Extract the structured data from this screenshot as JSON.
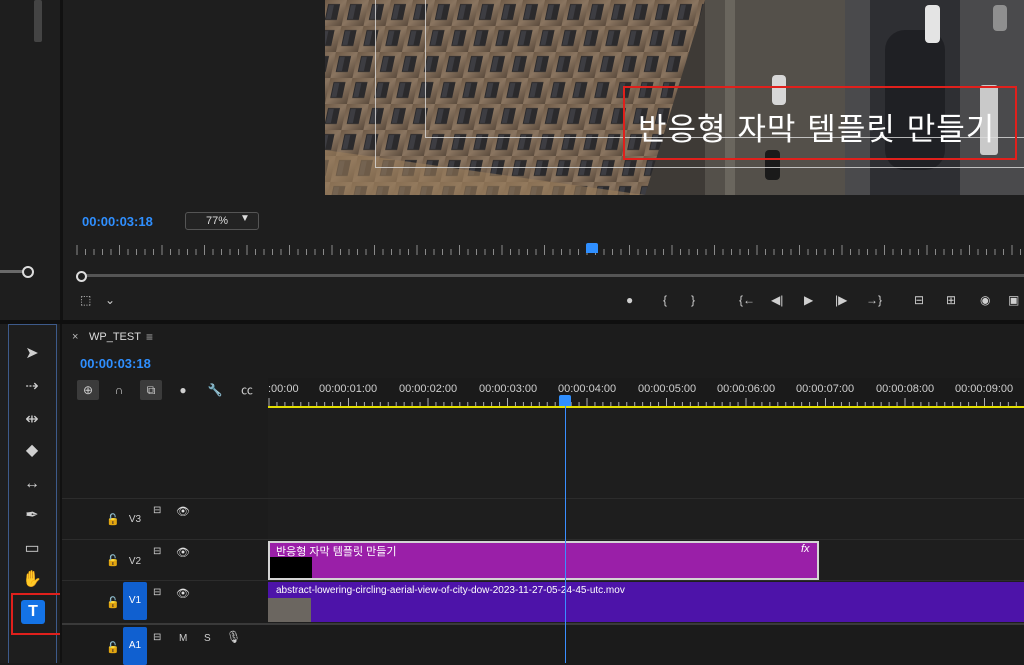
{
  "program_monitor": {
    "title_overlay": "반응형 자막 템플릿 만들기",
    "timecode": "00:00:03:18",
    "zoom": "77%",
    "playhead_fraction": 0.545
  },
  "transport": {
    "marker": "●",
    "in": "{",
    "out": "}",
    "goto_in": "{←",
    "step_back": "◀|",
    "play": "▶",
    "step_fwd": "|▶",
    "goto_out": "→}",
    "lift": "⊟",
    "extract": "⊞",
    "export_frame": "◉"
  },
  "tools": [
    {
      "name": "selection-tool",
      "glyph": "➤"
    },
    {
      "name": "track-select-tool",
      "glyph": "⇢"
    },
    {
      "name": "ripple-edit-tool",
      "glyph": "⇹"
    },
    {
      "name": "razor-tool",
      "glyph": "◆"
    },
    {
      "name": "slip-tool",
      "glyph": "↔"
    },
    {
      "name": "pen-tool",
      "glyph": "✒"
    },
    {
      "name": "rectangle-tool",
      "glyph": "▭"
    },
    {
      "name": "hand-tool",
      "glyph": "✋"
    }
  ],
  "type_tool": "T",
  "sequence": {
    "close": "×",
    "name": "WP_TEST",
    "menu": "≡",
    "timecode": "00:00:03:18",
    "ruler": [
      ":00:00",
      "00:00:01:00",
      "00:00:02:00",
      "00:00:03:00",
      "00:00:04:00",
      "00:00:05:00",
      "00:00:06:00",
      "00:00:07:00",
      "00:00:08:00",
      "00:00:09:00"
    ],
    "options": [
      "⊕",
      "∩",
      "⧉",
      "●",
      "🔧",
      "㏄"
    ]
  },
  "tracks": [
    {
      "label": "V3",
      "lock": "🔓",
      "sync": "⊟",
      "eye": "👁"
    },
    {
      "label": "V2",
      "lock": "🔓",
      "sync": "⊟",
      "eye": "👁"
    },
    {
      "label": "V1",
      "lock": "🔓",
      "sync": "⊟",
      "eye": "👁"
    },
    {
      "label": "A1",
      "lock": "🔓",
      "sync": "⊟",
      "mute": "M",
      "solo": "S",
      "mic": "🎙"
    }
  ],
  "clips": {
    "title_clip": {
      "name": "반응형 자막 템플릿 만들기",
      "fx": "fx"
    },
    "video_clip": {
      "name": "abstract-lowering-circling-aerial-view-of-city-dow-2023-11-27-05-24-45-utc.mov"
    }
  },
  "colors": {
    "accent": "#2f8fff",
    "title_clip": "#9a1fa8",
    "video_clip": "#4d13a9",
    "highlight": "#e0201c",
    "work_area": "#e5e000"
  }
}
